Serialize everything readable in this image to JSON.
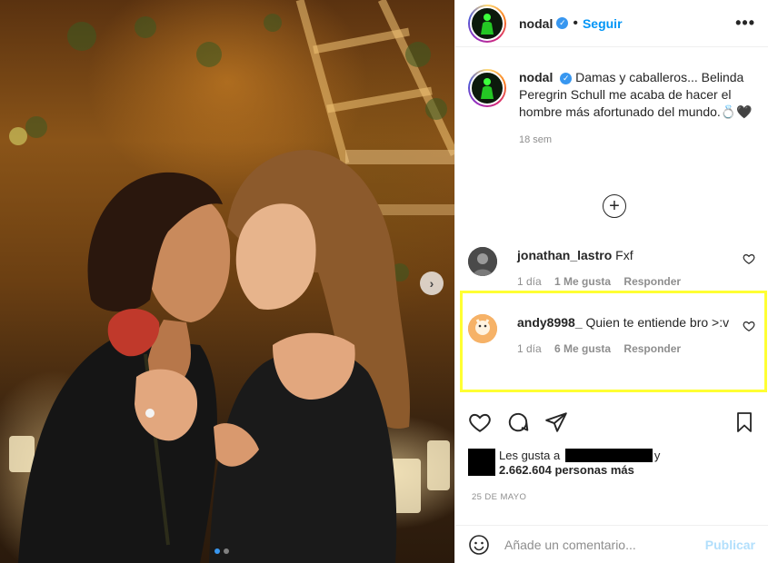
{
  "post": {
    "author": "nodal",
    "follow_label": "Seguir",
    "separator": "•",
    "more_label": "•••",
    "caption": {
      "user": "nodal",
      "text": "Damas y caballeros... Belinda Peregrin Schull me acaba de hacer el hombre más afortunado del mundo.💍🖤",
      "time": "18 sem"
    },
    "load_more_label": "+"
  },
  "comments": [
    {
      "user": "jonathan_lastro",
      "text": "Fxf",
      "time": "1 día",
      "likes": "1 Me gusta",
      "reply": "Responder"
    },
    {
      "user": "andy8998_",
      "text": "Quien te entiende bro >:v",
      "time": "1 día",
      "likes": "6 Me gusta",
      "reply": "Responder"
    }
  ],
  "likes_summary": {
    "prefix": "Les gusta a",
    "suffix": "y",
    "count_text": "2.662.604 personas más"
  },
  "post_date": "25 DE MAYO",
  "composer": {
    "placeholder": "Añade un comentario...",
    "publish_label": "Publicar"
  },
  "carousel": {
    "next_label": "›",
    "slides": 2,
    "active_slide": 1
  },
  "colors": {
    "link_blue": "#0095f6",
    "verified_blue": "#3897f0",
    "highlight_yellow": "#ffff33",
    "muted": "#8e8e8e"
  },
  "icons": [
    "verified-badge-icon",
    "more-options-icon",
    "add-circle-icon",
    "heart-icon",
    "comment-icon",
    "share-icon",
    "bookmark-icon",
    "emoji-icon",
    "chevron-right-icon"
  ]
}
